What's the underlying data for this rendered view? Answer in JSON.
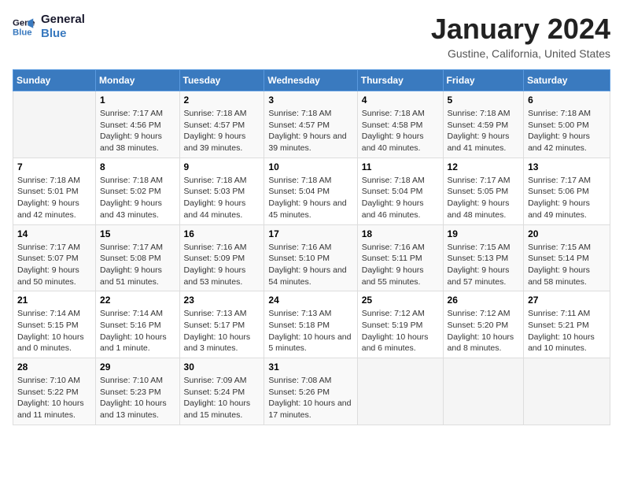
{
  "header": {
    "logo_line1": "General",
    "logo_line2": "Blue",
    "title": "January 2024",
    "subtitle": "Gustine, California, United States"
  },
  "weekdays": [
    "Sunday",
    "Monday",
    "Tuesday",
    "Wednesday",
    "Thursday",
    "Friday",
    "Saturday"
  ],
  "weeks": [
    [
      {
        "day": "",
        "sunrise": "",
        "sunset": "",
        "daylight": ""
      },
      {
        "day": "1",
        "sunrise": "Sunrise: 7:17 AM",
        "sunset": "Sunset: 4:56 PM",
        "daylight": "Daylight: 9 hours and 38 minutes."
      },
      {
        "day": "2",
        "sunrise": "Sunrise: 7:18 AM",
        "sunset": "Sunset: 4:57 PM",
        "daylight": "Daylight: 9 hours and 39 minutes."
      },
      {
        "day": "3",
        "sunrise": "Sunrise: 7:18 AM",
        "sunset": "Sunset: 4:57 PM",
        "daylight": "Daylight: 9 hours and 39 minutes."
      },
      {
        "day": "4",
        "sunrise": "Sunrise: 7:18 AM",
        "sunset": "Sunset: 4:58 PM",
        "daylight": "Daylight: 9 hours and 40 minutes."
      },
      {
        "day": "5",
        "sunrise": "Sunrise: 7:18 AM",
        "sunset": "Sunset: 4:59 PM",
        "daylight": "Daylight: 9 hours and 41 minutes."
      },
      {
        "day": "6",
        "sunrise": "Sunrise: 7:18 AM",
        "sunset": "Sunset: 5:00 PM",
        "daylight": "Daylight: 9 hours and 42 minutes."
      }
    ],
    [
      {
        "day": "7",
        "sunrise": "Sunrise: 7:18 AM",
        "sunset": "Sunset: 5:01 PM",
        "daylight": "Daylight: 9 hours and 42 minutes."
      },
      {
        "day": "8",
        "sunrise": "Sunrise: 7:18 AM",
        "sunset": "Sunset: 5:02 PM",
        "daylight": "Daylight: 9 hours and 43 minutes."
      },
      {
        "day": "9",
        "sunrise": "Sunrise: 7:18 AM",
        "sunset": "Sunset: 5:03 PM",
        "daylight": "Daylight: 9 hours and 44 minutes."
      },
      {
        "day": "10",
        "sunrise": "Sunrise: 7:18 AM",
        "sunset": "Sunset: 5:04 PM",
        "daylight": "Daylight: 9 hours and 45 minutes."
      },
      {
        "day": "11",
        "sunrise": "Sunrise: 7:18 AM",
        "sunset": "Sunset: 5:04 PM",
        "daylight": "Daylight: 9 hours and 46 minutes."
      },
      {
        "day": "12",
        "sunrise": "Sunrise: 7:17 AM",
        "sunset": "Sunset: 5:05 PM",
        "daylight": "Daylight: 9 hours and 48 minutes."
      },
      {
        "day": "13",
        "sunrise": "Sunrise: 7:17 AM",
        "sunset": "Sunset: 5:06 PM",
        "daylight": "Daylight: 9 hours and 49 minutes."
      }
    ],
    [
      {
        "day": "14",
        "sunrise": "Sunrise: 7:17 AM",
        "sunset": "Sunset: 5:07 PM",
        "daylight": "Daylight: 9 hours and 50 minutes."
      },
      {
        "day": "15",
        "sunrise": "Sunrise: 7:17 AM",
        "sunset": "Sunset: 5:08 PM",
        "daylight": "Daylight: 9 hours and 51 minutes."
      },
      {
        "day": "16",
        "sunrise": "Sunrise: 7:16 AM",
        "sunset": "Sunset: 5:09 PM",
        "daylight": "Daylight: 9 hours and 53 minutes."
      },
      {
        "day": "17",
        "sunrise": "Sunrise: 7:16 AM",
        "sunset": "Sunset: 5:10 PM",
        "daylight": "Daylight: 9 hours and 54 minutes."
      },
      {
        "day": "18",
        "sunrise": "Sunrise: 7:16 AM",
        "sunset": "Sunset: 5:11 PM",
        "daylight": "Daylight: 9 hours and 55 minutes."
      },
      {
        "day": "19",
        "sunrise": "Sunrise: 7:15 AM",
        "sunset": "Sunset: 5:13 PM",
        "daylight": "Daylight: 9 hours and 57 minutes."
      },
      {
        "day": "20",
        "sunrise": "Sunrise: 7:15 AM",
        "sunset": "Sunset: 5:14 PM",
        "daylight": "Daylight: 9 hours and 58 minutes."
      }
    ],
    [
      {
        "day": "21",
        "sunrise": "Sunrise: 7:14 AM",
        "sunset": "Sunset: 5:15 PM",
        "daylight": "Daylight: 10 hours and 0 minutes."
      },
      {
        "day": "22",
        "sunrise": "Sunrise: 7:14 AM",
        "sunset": "Sunset: 5:16 PM",
        "daylight": "Daylight: 10 hours and 1 minute."
      },
      {
        "day": "23",
        "sunrise": "Sunrise: 7:13 AM",
        "sunset": "Sunset: 5:17 PM",
        "daylight": "Daylight: 10 hours and 3 minutes."
      },
      {
        "day": "24",
        "sunrise": "Sunrise: 7:13 AM",
        "sunset": "Sunset: 5:18 PM",
        "daylight": "Daylight: 10 hours and 5 minutes."
      },
      {
        "day": "25",
        "sunrise": "Sunrise: 7:12 AM",
        "sunset": "Sunset: 5:19 PM",
        "daylight": "Daylight: 10 hours and 6 minutes."
      },
      {
        "day": "26",
        "sunrise": "Sunrise: 7:12 AM",
        "sunset": "Sunset: 5:20 PM",
        "daylight": "Daylight: 10 hours and 8 minutes."
      },
      {
        "day": "27",
        "sunrise": "Sunrise: 7:11 AM",
        "sunset": "Sunset: 5:21 PM",
        "daylight": "Daylight: 10 hours and 10 minutes."
      }
    ],
    [
      {
        "day": "28",
        "sunrise": "Sunrise: 7:10 AM",
        "sunset": "Sunset: 5:22 PM",
        "daylight": "Daylight: 10 hours and 11 minutes."
      },
      {
        "day": "29",
        "sunrise": "Sunrise: 7:10 AM",
        "sunset": "Sunset: 5:23 PM",
        "daylight": "Daylight: 10 hours and 13 minutes."
      },
      {
        "day": "30",
        "sunrise": "Sunrise: 7:09 AM",
        "sunset": "Sunset: 5:24 PM",
        "daylight": "Daylight: 10 hours and 15 minutes."
      },
      {
        "day": "31",
        "sunrise": "Sunrise: 7:08 AM",
        "sunset": "Sunset: 5:26 PM",
        "daylight": "Daylight: 10 hours and 17 minutes."
      },
      {
        "day": "",
        "sunrise": "",
        "sunset": "",
        "daylight": ""
      },
      {
        "day": "",
        "sunrise": "",
        "sunset": "",
        "daylight": ""
      },
      {
        "day": "",
        "sunrise": "",
        "sunset": "",
        "daylight": ""
      }
    ]
  ]
}
